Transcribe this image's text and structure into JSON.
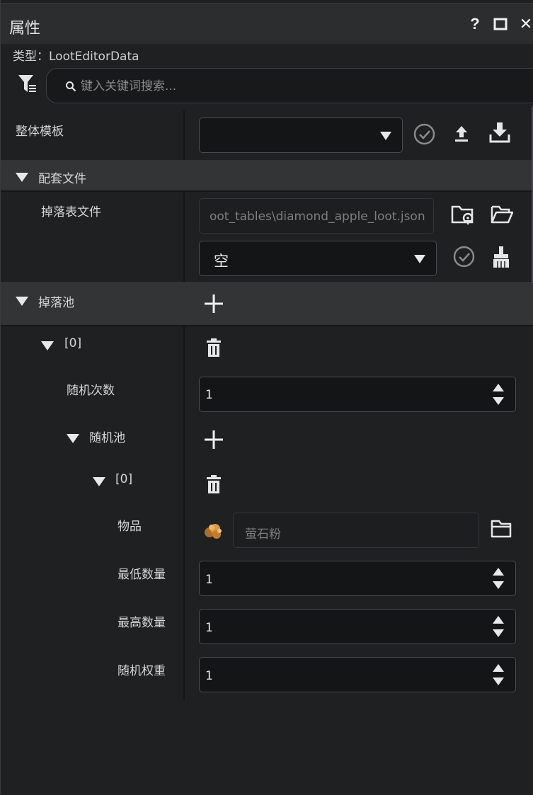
{
  "window": {
    "title": "属性",
    "help_label": "?",
    "close_label": "✕"
  },
  "type_line": "类型：LootEditorData",
  "search": {
    "placeholder": "键入关键词搜索..."
  },
  "rows": {
    "template": {
      "label": "整体模板",
      "value": ""
    },
    "section_files": {
      "label": "配套文件"
    },
    "loot_file": {
      "label": "掉落表文件",
      "path": "oot_tables\\diamond_apple_loot.json",
      "select_value": "空"
    },
    "section_pools": {
      "label": "掉落池"
    },
    "pool0": {
      "label": "[0]"
    },
    "rolls": {
      "label": "随机次数",
      "value": "1"
    },
    "random_pool": {
      "label": "随机池"
    },
    "entry0": {
      "label": "[0]"
    },
    "item": {
      "label": "物品",
      "value": "萤石粉"
    },
    "min_count": {
      "label": "最低数量",
      "value": "1"
    },
    "max_count": {
      "label": "最高数量",
      "value": "1"
    },
    "weight": {
      "label": "随机权重",
      "value": "1"
    }
  },
  "colors": {
    "background": "#1f2022",
    "titlebar": "#2c2d2f",
    "section": "#333436",
    "field": "#141517",
    "accent_item": "#c98a3a"
  },
  "icons": [
    "filter-icon",
    "search-icon",
    "check-icon",
    "upload-icon",
    "download-icon",
    "folder-location-icon",
    "folder-open-icon",
    "broom-icon",
    "plus-icon",
    "trash-icon",
    "glowstone-dust-icon",
    "folder-icon"
  ]
}
